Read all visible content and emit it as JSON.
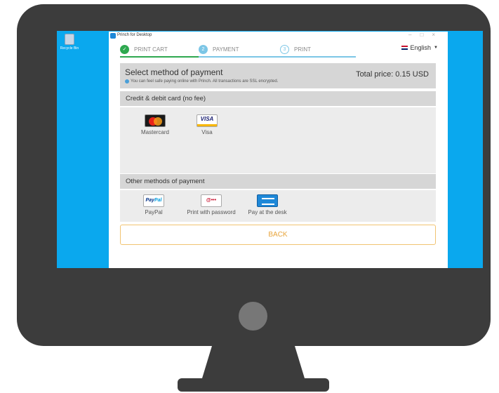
{
  "desktop": {
    "icon_label": "Recycle Bin"
  },
  "window": {
    "title": "Princh for Desktop",
    "controls": [
      "–",
      "□",
      "×"
    ]
  },
  "steps": [
    {
      "num": "✓",
      "label": "PRINT CART"
    },
    {
      "num": "2",
      "label": "PAYMENT"
    },
    {
      "num": "3",
      "label": "PRINT"
    }
  ],
  "language": {
    "selected": "English"
  },
  "header": {
    "title": "Select method of payment",
    "subtitle": "You can feel safe paying online with Princh. All transactions are SSL encrypted.",
    "total": "Total price: 0.15 USD"
  },
  "cards_section": {
    "title": "Credit & debit card (no fee)",
    "methods": [
      {
        "label": "Mastercard",
        "icon_text": ""
      },
      {
        "label": "Visa",
        "icon_text": "VISA"
      }
    ]
  },
  "other_section": {
    "title": "Other methods of payment",
    "methods": [
      {
        "label": "PayPal",
        "icon_text_a": "Pay",
        "icon_text_b": "Pal"
      },
      {
        "label": "Print with password",
        "icon_text": "@•••"
      },
      {
        "label": "Pay at the desk",
        "icon_text": ""
      }
    ]
  },
  "back_button": {
    "label": "BACK"
  },
  "colors": {
    "accent": "#0aa8ee",
    "success": "#2ea84f",
    "step": "#7cc6e6",
    "button_border": "#f1c371"
  }
}
